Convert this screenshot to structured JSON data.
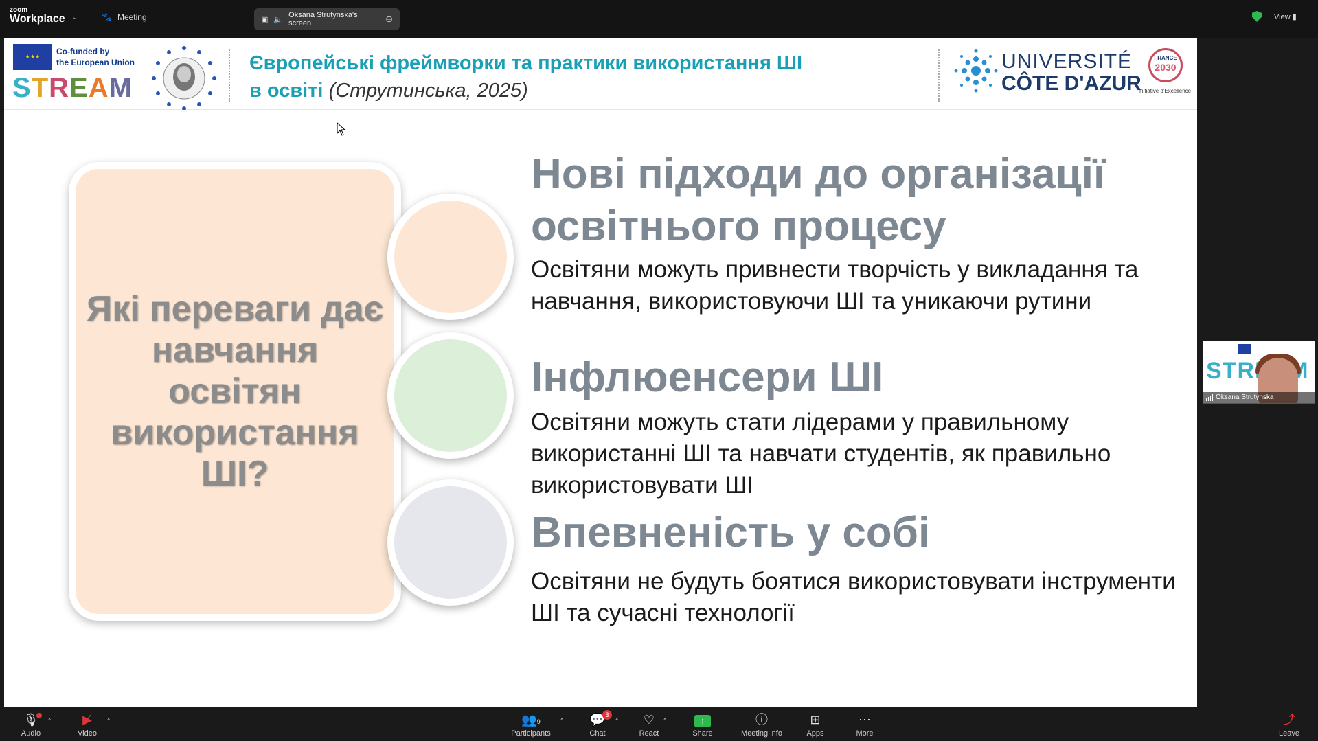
{
  "app": {
    "logo_line1": "zoom",
    "logo_line2": "Workplace",
    "meeting_label": "Meeting",
    "screen_tab_label": "Oksana Strutynska's screen",
    "view_label": "View"
  },
  "slide_header": {
    "eu_text_line1": "Co-funded by",
    "eu_text_line2": "the European Union",
    "stream_logo": "STREAM",
    "title_main_line1": "Європейські фреймворки та практики використання ШІ",
    "title_main_line2": "в освіті",
    "title_italic": "(Струтинська, 2025)",
    "uca_line1": "UNIVERSITÉ",
    "uca_line2": "CÔTE D'AZUR",
    "france_top": "FRANCE",
    "france_year": "2030",
    "france_bottom": "Initiative d'Excellence"
  },
  "slide": {
    "question": "Які переваги дає навчання освітян використання ШІ?",
    "items": [
      {
        "heading_line1": "Нові підходи до організації",
        "heading_line2": "освітнього процесу",
        "body": "Освітяни можуть привнести творчість у викладання та навчання, використовуючи ШІ та уникаючи рутини"
      },
      {
        "heading_line1": "Інфлюенсери ШІ",
        "body": "Освітяни можуть стати лідерами у правильному використанні ШІ та навчати студентів, як правильно використовувати ШІ"
      },
      {
        "heading_line1": "Впевненість у собі",
        "body": "Освітяни не будуть боятися використовувати інструменти ШІ та сучасні технології"
      }
    ],
    "circle_colors": [
      "#fde7d4",
      "#dcefd9",
      "#e5e7ec"
    ]
  },
  "self_view": {
    "name": "Oksana Strutynska",
    "logo": "STREAM"
  },
  "controls": {
    "audio": "Audio",
    "video": "Video",
    "participants": "Participants",
    "participants_count": "9",
    "chat": "Chat",
    "chat_badge": "3",
    "react": "React",
    "share": "Share",
    "meeting_info": "Meeting info",
    "apps": "Apps",
    "more": "More",
    "leave": "Leave"
  },
  "colors": {
    "title_teal": "#1aa0b5",
    "heading_gray": "#7d8892",
    "share_green": "#2fb84f",
    "alert_red": "#e0343c"
  }
}
